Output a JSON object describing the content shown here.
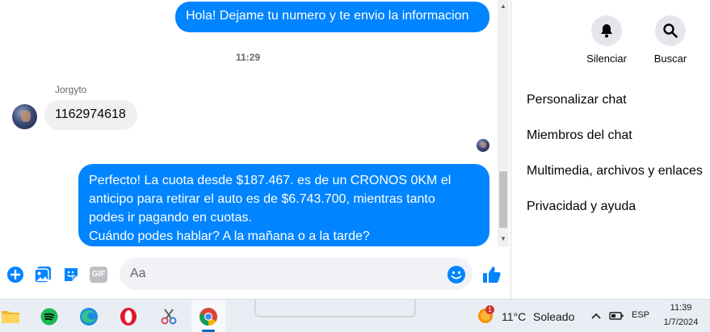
{
  "chat": {
    "top_message": "Hola! Dejame tu numero y te envio la informacion",
    "timestamp": "11:29",
    "sender_name": "Jorgyto",
    "incoming_message": "1162974618",
    "outgoing_lines": [
      "Perfecto! La cuota desde $187.467. es de un CRONOS 0KM el",
      "anticipo para retirar el auto es de $6.743.700, mientras tanto",
      "podes ir pagando en cuotas.",
      "Cuándo podes hablar? A la mañana o a la tarde?"
    ]
  },
  "composer": {
    "placeholder": "Aa",
    "gif_label": "GIF",
    "icons": [
      "add-icon",
      "image-icon",
      "sticker-icon",
      "gif-icon",
      "emoji-icon",
      "like-icon"
    ]
  },
  "side_panel": {
    "actions": [
      {
        "label": "Silenciar",
        "icon": "bell-icon"
      },
      {
        "label": "Buscar",
        "icon": "search-icon"
      }
    ],
    "menu": [
      "Personalizar chat",
      "Miembros del chat",
      "Multimedia, archivos y enlaces",
      "Privacidad y ayuda"
    ]
  },
  "taskbar": {
    "apps": [
      "file-explorer-icon",
      "spotify-icon",
      "edge-icon",
      "opera-icon",
      "snipping-tool-icon",
      "chrome-icon"
    ],
    "weather_badge": "1",
    "weather_temp": "11°C",
    "weather_text": "Soleado",
    "language": "ESP",
    "time": "11:39",
    "date": "1/7/2024"
  },
  "colors": {
    "accent": "#0084ff",
    "incoming_bubble": "#f0f0f0",
    "taskbar": "#e9eef5"
  }
}
